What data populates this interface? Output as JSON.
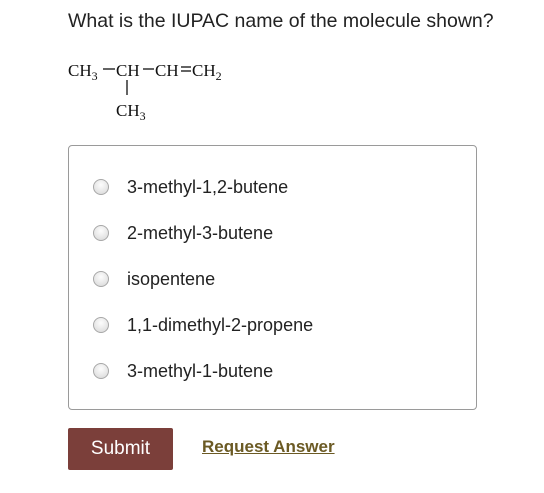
{
  "question": {
    "text": "What is the IUPAC name of the molecule shown?"
  },
  "structure": {
    "ch3_top": "CH",
    "ch3_top_sub": "3",
    "ch_1": "CH",
    "ch_2": "CH",
    "ch2": "CH",
    "ch2_sub": "2",
    "ch3_bottom": "CH",
    "ch3_bottom_sub": "3"
  },
  "options": [
    {
      "label": "3-methyl-1,2-butene"
    },
    {
      "label": "2-methyl-3-butene"
    },
    {
      "label": "isopentene"
    },
    {
      "label": "1,1-dimethyl-2-propene"
    },
    {
      "label": "3-methyl-1-butene"
    }
  ],
  "actions": {
    "submit_label": "Submit",
    "request_label": "Request Answer"
  },
  "colors": {
    "submit_bg": "#7b3f3a",
    "request_link": "#6b5a24"
  }
}
